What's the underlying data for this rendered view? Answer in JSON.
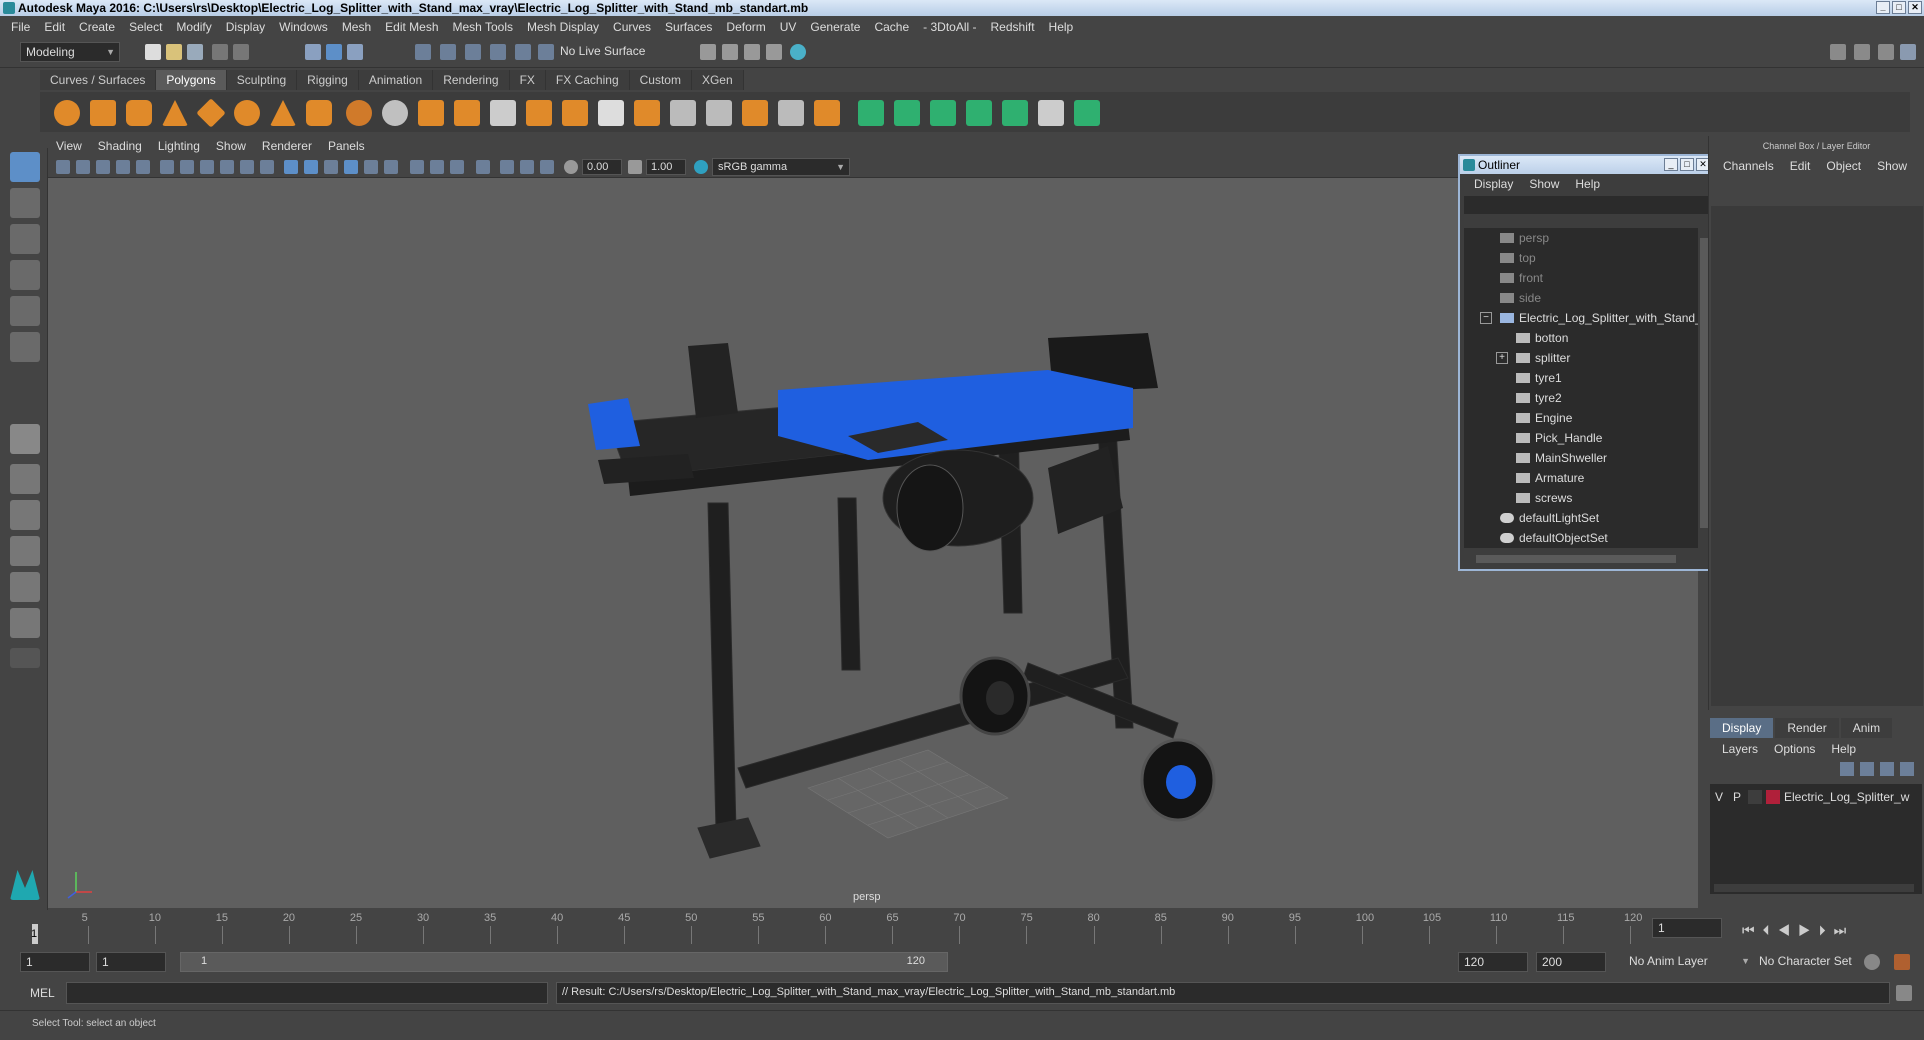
{
  "window": {
    "title": "Autodesk Maya 2016: C:\\Users\\rs\\Desktop\\Electric_Log_Splitter_with_Stand_max_vray\\Electric_Log_Splitter_with_Stand_mb_standart.mb"
  },
  "menubar": [
    "File",
    "Edit",
    "Create",
    "Select",
    "Modify",
    "Display",
    "Windows",
    "Mesh",
    "Edit Mesh",
    "Mesh Tools",
    "Mesh Display",
    "Curves",
    "Surfaces",
    "Deform",
    "UV",
    "Generate",
    "Cache",
    "- 3DtoAll -",
    "Redshift",
    "Help"
  ],
  "toolbar": {
    "mode": "Modeling",
    "live_surface": "No Live Surface"
  },
  "shelf_tabs": [
    "Curves / Surfaces",
    "Polygons",
    "Sculpting",
    "Rigging",
    "Animation",
    "Rendering",
    "FX",
    "FX Caching",
    "Custom",
    "XGen"
  ],
  "shelf_active": "Polygons",
  "panel_menu": [
    "View",
    "Shading",
    "Lighting",
    "Show",
    "Renderer",
    "Panels"
  ],
  "panel_toolbar": {
    "exposure": "0.00",
    "gamma": "1.00",
    "color_space": "sRGB gamma"
  },
  "viewport": {
    "camera_label": "persp"
  },
  "outliner": {
    "title": "Outliner",
    "menu": [
      "Display",
      "Show",
      "Help"
    ],
    "items": [
      {
        "label": "persp",
        "dim": true,
        "indent": 1,
        "icon": "camera-icon"
      },
      {
        "label": "top",
        "dim": true,
        "indent": 1,
        "icon": "camera-icon"
      },
      {
        "label": "front",
        "dim": true,
        "indent": 1,
        "icon": "camera-icon"
      },
      {
        "label": "side",
        "dim": true,
        "indent": 1,
        "icon": "camera-icon"
      },
      {
        "label": "Electric_Log_Splitter_with_Stand_",
        "dim": false,
        "indent": 1,
        "icon": "group-icon",
        "expander": "-"
      },
      {
        "label": "botton",
        "dim": false,
        "indent": 2,
        "icon": "mesh-icon"
      },
      {
        "label": "splitter",
        "dim": false,
        "indent": 2,
        "icon": "mesh-icon",
        "expander": "+"
      },
      {
        "label": "tyre1",
        "dim": false,
        "indent": 2,
        "icon": "mesh-icon"
      },
      {
        "label": "tyre2",
        "dim": false,
        "indent": 2,
        "icon": "mesh-icon"
      },
      {
        "label": "Engine",
        "dim": false,
        "indent": 2,
        "icon": "mesh-icon"
      },
      {
        "label": "Pick_Handle",
        "dim": false,
        "indent": 2,
        "icon": "mesh-icon"
      },
      {
        "label": "MainShweller",
        "dim": false,
        "indent": 2,
        "icon": "mesh-icon"
      },
      {
        "label": "Armature",
        "dim": false,
        "indent": 2,
        "icon": "mesh-icon"
      },
      {
        "label": "screws",
        "dim": false,
        "indent": 2,
        "icon": "mesh-icon"
      },
      {
        "label": "defaultLightSet",
        "dim": false,
        "indent": 1,
        "icon": "set-icon"
      },
      {
        "label": "defaultObjectSet",
        "dim": false,
        "indent": 1,
        "icon": "set-icon"
      }
    ]
  },
  "channel_box": {
    "header": "Channel Box / Layer Editor",
    "menu": [
      "Channels",
      "Edit",
      "Object",
      "Show"
    ]
  },
  "layer_editor": {
    "tabs": [
      "Display",
      "Render",
      "Anim"
    ],
    "active_tab": "Display",
    "menu": [
      "Layers",
      "Options",
      "Help"
    ],
    "layer": {
      "v": "V",
      "p": "P",
      "name": "Electric_Log_Splitter_w",
      "color": "#b0203a"
    }
  },
  "timeline": {
    "ticks": [
      "5",
      "10",
      "15",
      "20",
      "25",
      "30",
      "35",
      "40",
      "45",
      "50",
      "55",
      "60",
      "65",
      "70",
      "75",
      "80",
      "85",
      "90",
      "95",
      "100",
      "105",
      "110",
      "115",
      "120"
    ],
    "current_frame_marker": "1",
    "current_frame": "1"
  },
  "range": {
    "start": "1",
    "start2": "1",
    "slider_start": "1",
    "slider_end": "120",
    "end": "120",
    "end2": "200",
    "anim_layer": "No Anim Layer",
    "character_set": "No Character Set"
  },
  "command": {
    "label": "MEL",
    "result": "// Result: C:/Users/rs/Desktop/Electric_Log_Splitter_with_Stand_max_vray/Electric_Log_Splitter_with_Stand_mb_standart.mb"
  },
  "help_line": "Select Tool: select an object",
  "colors": {
    "accent_blue": "#1f5fe0",
    "maya_teal": "#1fa8b0",
    "shelf_orange": "#e08a2a"
  }
}
